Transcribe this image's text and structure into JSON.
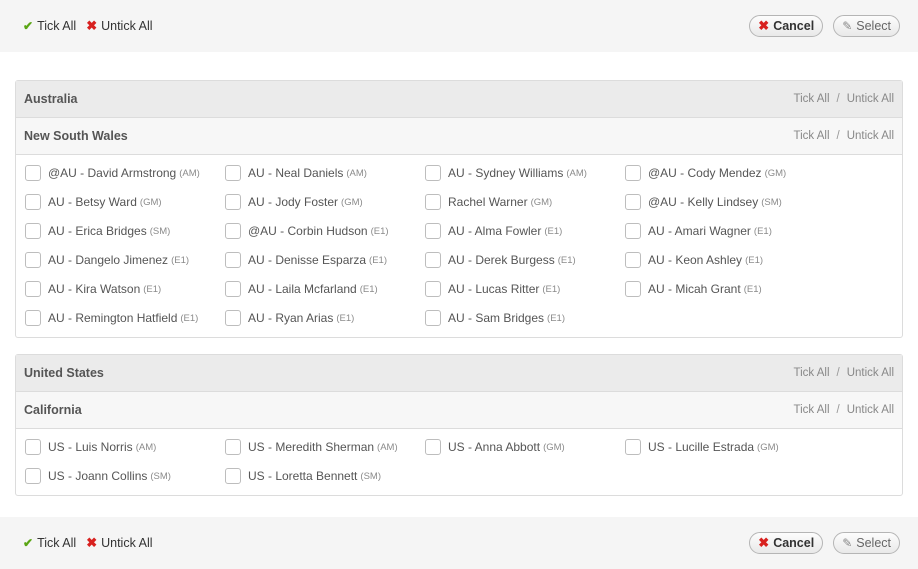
{
  "toolbar": {
    "tick_all": "Tick All",
    "untick_all": "Untick All",
    "cancel": "Cancel",
    "select": "Select"
  },
  "head_links": {
    "tick_all": "Tick All",
    "sep": "/",
    "untick_all": "Untick All"
  },
  "regions": [
    {
      "name": "Australia",
      "sub": "New South Wales",
      "people": [
        {
          "name": "@AU - David Armstrong",
          "tag": "(AM)"
        },
        {
          "name": "AU - Neal Daniels",
          "tag": "(AM)"
        },
        {
          "name": "AU - Sydney Williams",
          "tag": "(AM)"
        },
        {
          "name": "@AU - Cody Mendez",
          "tag": "(GM)"
        },
        {
          "name": "AU - Betsy Ward",
          "tag": "(GM)"
        },
        {
          "name": "AU - Jody Foster",
          "tag": "(GM)"
        },
        {
          "name": "Rachel Warner",
          "tag": "(GM)"
        },
        {
          "name": "@AU - Kelly Lindsey",
          "tag": "(SM)"
        },
        {
          "name": "AU - Erica Bridges",
          "tag": "(SM)"
        },
        {
          "name": "@AU - Corbin Hudson",
          "tag": "(E1)"
        },
        {
          "name": "AU - Alma Fowler",
          "tag": "(E1)"
        },
        {
          "name": "AU - Amari Wagner",
          "tag": "(E1)"
        },
        {
          "name": "AU - Dangelo Jimenez",
          "tag": "(E1)"
        },
        {
          "name": "AU - Denisse Esparza",
          "tag": "(E1)"
        },
        {
          "name": "AU - Derek Burgess",
          "tag": "(E1)"
        },
        {
          "name": "AU - Keon Ashley",
          "tag": "(E1)"
        },
        {
          "name": "AU - Kira Watson",
          "tag": "(E1)"
        },
        {
          "name": "AU - Laila Mcfarland",
          "tag": "(E1)"
        },
        {
          "name": "AU - Lucas Ritter",
          "tag": "(E1)"
        },
        {
          "name": "AU - Micah Grant",
          "tag": "(E1)"
        },
        {
          "name": "AU - Remington Hatfield",
          "tag": "(E1)"
        },
        {
          "name": "AU - Ryan Arias",
          "tag": "(E1)"
        },
        {
          "name": "AU - Sam Bridges",
          "tag": "(E1)"
        }
      ]
    },
    {
      "name": "United States",
      "sub": "California",
      "people": [
        {
          "name": "US - Luis Norris",
          "tag": "(AM)"
        },
        {
          "name": "US - Meredith Sherman",
          "tag": "(AM)"
        },
        {
          "name": "US - Anna Abbott",
          "tag": "(GM)"
        },
        {
          "name": "US - Lucille Estrada",
          "tag": "(GM)"
        },
        {
          "name": "US - Joann Collins",
          "tag": "(SM)"
        },
        {
          "name": "US - Loretta Bennett",
          "tag": "(SM)"
        }
      ]
    }
  ]
}
